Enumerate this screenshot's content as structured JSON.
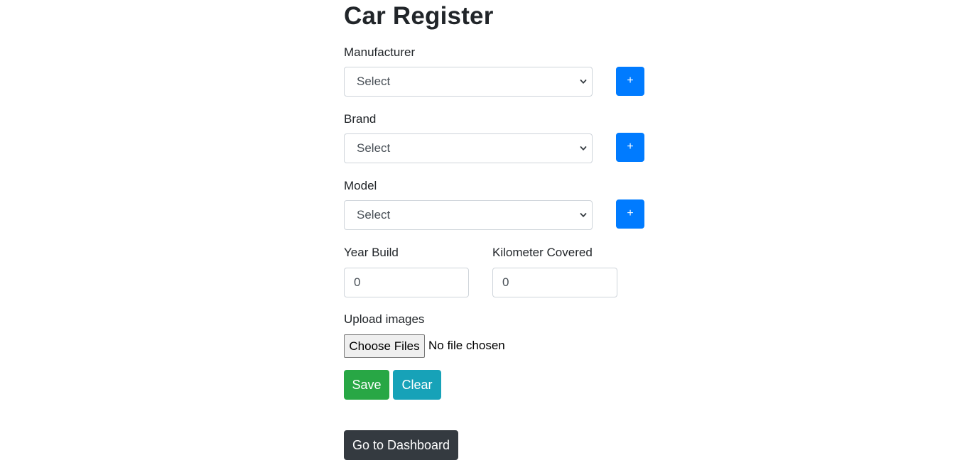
{
  "page": {
    "title": "Car Register"
  },
  "form": {
    "manufacturer": {
      "label": "Manufacturer",
      "selected": "Select",
      "add_label": "+"
    },
    "brand": {
      "label": "Brand",
      "selected": "Select",
      "add_label": "+"
    },
    "model": {
      "label": "Model",
      "selected": "Select",
      "add_label": "+"
    },
    "year_build": {
      "label": "Year Build",
      "value": "0"
    },
    "kilometer_covered": {
      "label": "Kilometer Covered",
      "value": "0"
    },
    "upload": {
      "label": "Upload images",
      "button_label": "Choose Files",
      "status": "No file chosen"
    }
  },
  "actions": {
    "save_label": "Save",
    "clear_label": "Clear",
    "dashboard_label": "Go to Dashboard"
  },
  "colors": {
    "primary": "#007bff",
    "success": "#28a745",
    "info": "#17a2b8",
    "dark": "#343a40"
  },
  "icons": {
    "select_arrow": "chevron-down-icon"
  }
}
